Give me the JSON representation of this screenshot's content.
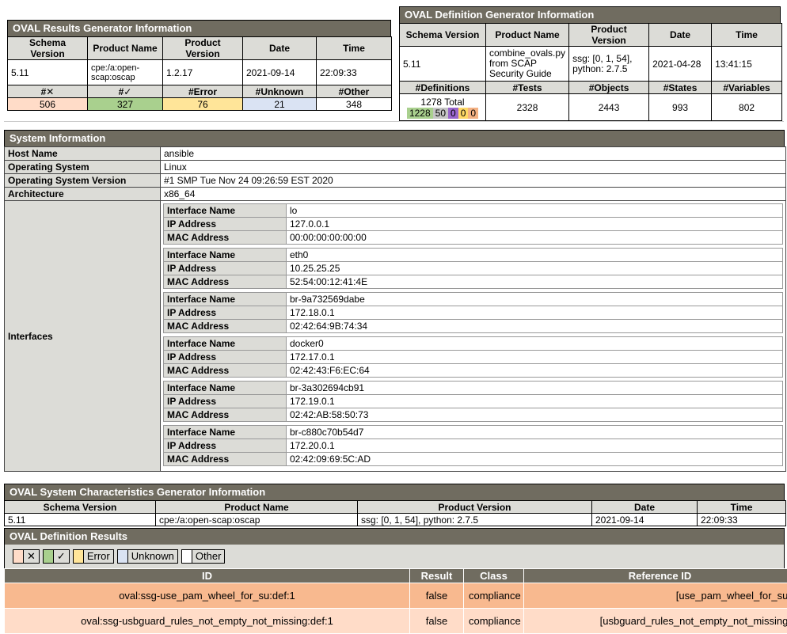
{
  "results_gen": {
    "title": "OVAL Results Generator Information",
    "headers": [
      "Schema Version",
      "Product Name",
      "Product Version",
      "Date",
      "Time"
    ],
    "values": [
      "5.11",
      "cpe:/a:open-scap:oscap",
      "1.2.17",
      "2021-09-14",
      "22:09:33"
    ],
    "count_headers": [
      "#✕",
      "#✓",
      "#Error",
      "#Unknown",
      "#Other"
    ],
    "counts": [
      "506",
      "327",
      "76",
      "21",
      "348"
    ],
    "count_colors": [
      "#ffdcc8",
      "#a9d08e",
      "#ffe599",
      "#dae3f3",
      "#ffffff"
    ]
  },
  "def_gen": {
    "title": "OVAL Definition Generator Information",
    "headers": [
      "Schema Version",
      "Product Name",
      "Product Version",
      "Date",
      "Time"
    ],
    "values": [
      "5.11",
      "combine_ovals.py from SCAP Security Guide",
      "ssg: [0, 1, 54], python: 2.7.5",
      "2021-04-28",
      "13:41:15"
    ],
    "count_headers": [
      "#Definitions",
      "#Tests",
      "#Objects",
      "#States",
      "#Variables"
    ],
    "total": "1278 Total",
    "breakdown": [
      {
        "v": "1228",
        "color": "#a9d08e"
      },
      {
        "v": "50",
        "color": "#c5c5c5"
      },
      {
        "v": "0",
        "color": "#9966cc"
      },
      {
        "v": "0",
        "color": "#ffd966"
      },
      {
        "v": "0",
        "color": "#f4b183"
      }
    ],
    "counts": [
      "2328",
      "2443",
      "993",
      "802"
    ]
  },
  "system": {
    "title": "System Information",
    "host_label": "Host Name",
    "host": "ansible",
    "os_label": "Operating System",
    "os": "Linux",
    "osv_label": "Operating System Version",
    "osv": "#1 SMP Tue Nov 24 09:26:59 EST 2020",
    "arch_label": "Architecture",
    "arch": "x86_64",
    "interfaces_label": "Interfaces",
    "if_name_label": "Interface Name",
    "ip_label": "IP Address",
    "mac_label": "MAC Address",
    "interfaces": [
      {
        "name": "lo",
        "ip": "127.0.0.1",
        "mac": "00:00:00:00:00:00"
      },
      {
        "name": "eth0",
        "ip": "10.25.25.25",
        "mac": "52:54:00:12:41:4E"
      },
      {
        "name": "br-9a732569dabe",
        "ip": "172.18.0.1",
        "mac": "02:42:64:9B:74:34"
      },
      {
        "name": "docker0",
        "ip": "172.17.0.1",
        "mac": "02:42:43:F6:EC:64"
      },
      {
        "name": "br-3a302694cb91",
        "ip": "172.19.0.1",
        "mac": "02:42:AB:58:50:73"
      },
      {
        "name": "br-c880c70b54d7",
        "ip": "172.20.0.1",
        "mac": "02:42:09:69:5C:AD"
      }
    ]
  },
  "sc_gen": {
    "title": "OVAL System Characteristics Generator Information",
    "headers": [
      "Schema Version",
      "Product Name",
      "Product Version",
      "Date",
      "Time"
    ],
    "values": [
      "5.11",
      "cpe:/a:open-scap:oscap",
      "ssg: [0, 1, 54], python: 2.7.5",
      "2021-09-14",
      "22:09:33"
    ]
  },
  "def_results": {
    "title": "OVAL Definition Results",
    "legend": [
      {
        "label": "✕",
        "color": "#ffdcc8"
      },
      {
        "label": "✓",
        "color": "#a9d08e"
      },
      {
        "label": "Error",
        "color": "#ffe599"
      },
      {
        "label": "Unknown",
        "color": "#dae3f3"
      },
      {
        "label": "Other",
        "color": "#ffffff"
      }
    ],
    "headers": [
      "ID",
      "Result",
      "Class",
      "Reference ID"
    ],
    "rows": [
      {
        "id": "oval:ssg-use_pam_wheel_for_su:def:1",
        "result": "false",
        "class": "compliance",
        "ref": "[use_pam_wheel_for_su]",
        "bg": "#f8b98f"
      },
      {
        "id": "oval:ssg-usbguard_rules_not_empty_not_missing:def:1",
        "result": "false",
        "class": "compliance",
        "ref": "[usbguard_rules_not_empty_not_missing]",
        "bg": "#ffdcc8"
      }
    ]
  }
}
